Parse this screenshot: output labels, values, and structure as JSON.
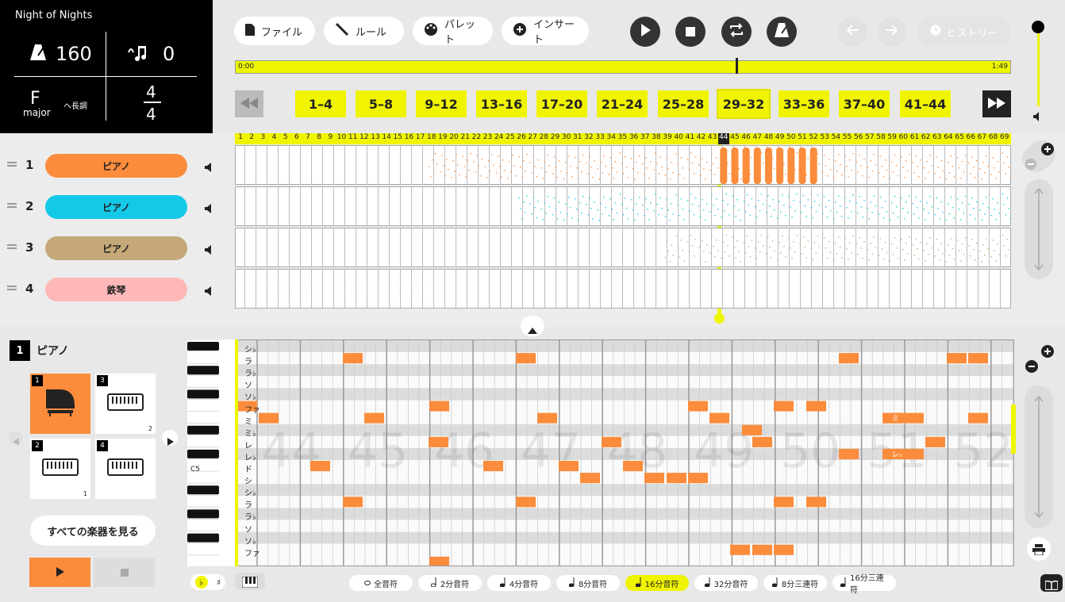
{
  "song": {
    "title": "Night of Nights",
    "tempo": "160",
    "countin": "0",
    "key_note": "F",
    "key_mode": "major",
    "key_jp": "ヘ長調",
    "time_top": "4",
    "time_bottom": "4"
  },
  "toolbar": {
    "file": "ファイル",
    "rule": "ルール",
    "palette": "パレット",
    "insert": "インサート",
    "history": "ヒストリー"
  },
  "timeline": {
    "start": "0:00",
    "end": "1:49",
    "progress": 0.645
  },
  "measures": [
    "1–4",
    "5–8",
    "9–12",
    "13–16",
    "17–20",
    "21–24",
    "25–28",
    "29–32",
    "33–36",
    "37–40",
    "41–44"
  ],
  "measure_numbers": [
    "1",
    "2",
    "3",
    "4",
    "5",
    "6",
    "7",
    "8",
    "9",
    "10",
    "11",
    "12",
    "13",
    "14",
    "15",
    "16",
    "17",
    "18",
    "19",
    "20",
    "21",
    "22",
    "23",
    "24",
    "25",
    "26",
    "27",
    "28",
    "29",
    "30",
    "31",
    "32",
    "33",
    "34",
    "35",
    "36",
    "37",
    "38",
    "39",
    "40",
    "41",
    "42",
    "43",
    "44",
    "45",
    "46",
    "47",
    "48",
    "49",
    "50",
    "51",
    "52",
    "53",
    "54",
    "55",
    "56",
    "57",
    "58",
    "59",
    "60",
    "61",
    "62",
    "63",
    "64",
    "65",
    "66",
    "67",
    "68",
    "69"
  ],
  "tracks": [
    {
      "num": "1",
      "name": "ピアノ",
      "color": "#fb8c3c"
    },
    {
      "num": "2",
      "name": "ピアノ",
      "color": "#14c8e8"
    },
    {
      "num": "3",
      "name": "ピアノ",
      "color": "#c4a878"
    },
    {
      "num": "4",
      "name": "鉄琴",
      "color": "#ffb8b8"
    }
  ],
  "selected": {
    "num": "1",
    "name": "ピアノ",
    "view_all": "すべての楽器を見る",
    "cards": [
      {
        "n": "1",
        "badge": ""
      },
      {
        "n": "3",
        "badge": "2"
      },
      {
        "n": "2",
        "badge": "1"
      },
      {
        "n": "4",
        "badge": ""
      }
    ]
  },
  "roll": {
    "c5": "C5",
    "rows": [
      "シ♭",
      "ラ",
      "ラ♭",
      "ソ",
      "ソ♭",
      "ファ",
      "ミ",
      "ミ♭",
      "レ",
      "レ♭",
      "ド",
      "シ",
      "シ♭",
      "ラ",
      "ラ♭",
      "ソ",
      "ソ♭",
      "ファ"
    ],
    "bg_measures": [
      "44",
      "45",
      "46",
      "47",
      "48",
      "49",
      "50",
      "51",
      "52"
    ],
    "note_labels": {
      "mi": "ミ",
      "reb": "レ♭"
    }
  },
  "durations": [
    "全音符",
    "2分音符",
    "4分音符",
    "8分音符",
    "16分音符",
    "32分音符",
    "8分三連符",
    "16分三連符"
  ],
  "flat": "♭",
  "sharp": "♯"
}
